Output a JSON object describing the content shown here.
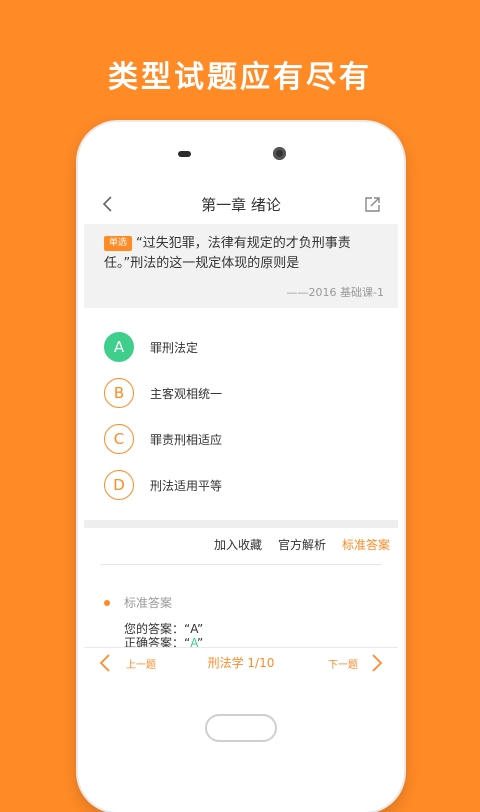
{
  "headline": "类型试题应有尽有",
  "nav": {
    "title": "第一章 绪论"
  },
  "question": {
    "badge": "单选",
    "text": "“过失犯罪，法律有规定的才负刑事责任。”刑法的这一规定体现的原则是",
    "source": "——2016 基础课-1"
  },
  "options": [
    {
      "letter": "A",
      "text": "罪刑法定",
      "correct": true
    },
    {
      "letter": "B",
      "text": "主客观相统一"
    },
    {
      "letter": "C",
      "text": "罪责刑相适应"
    },
    {
      "letter": "D",
      "text": "刑法适用平等"
    }
  ],
  "tabs": [
    "加入收藏",
    "官方解析",
    "标准答案"
  ],
  "active_tab": "标准答案",
  "answer": {
    "heading": "标准答案",
    "yours_label": "您的答案：",
    "yours_value": "“A”",
    "correct_label": "正确答案：",
    "correct_value_open": "“",
    "correct_value": "A",
    "correct_value_close": "”"
  },
  "bottom": {
    "prev": "上一题",
    "progress": "刑法学 1/10",
    "next": "下一题"
  },
  "colors": {
    "accent": "#FF8A26",
    "correct": "#3FCE8C"
  },
  "icons": [
    "back-icon",
    "share-icon",
    "prev-arrow-icon",
    "next-arrow-icon"
  ]
}
